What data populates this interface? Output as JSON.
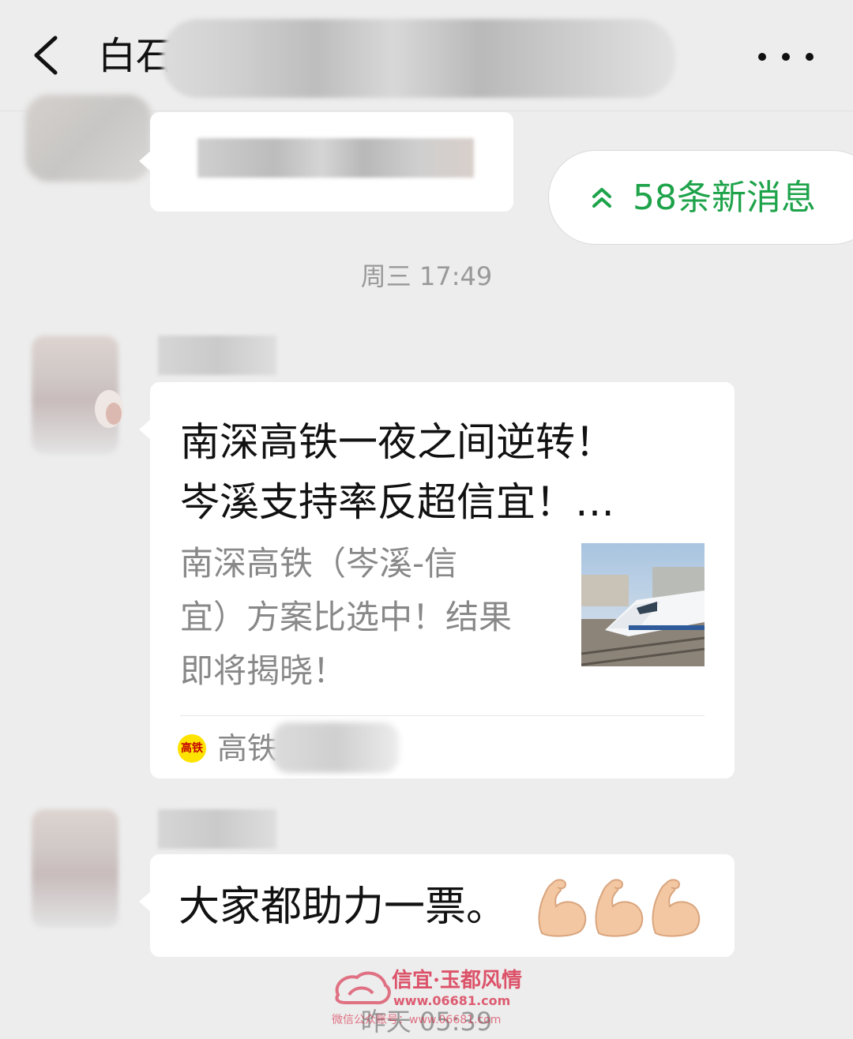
{
  "header": {
    "title": "白石",
    "back_icon": "chevron-left-icon",
    "more_icon": "more-dots-icon"
  },
  "new_messages": {
    "label": "58条新消息",
    "icon": "double-chevron-up-icon",
    "color": "#1ea34a"
  },
  "timestamps": {
    "first": "周三 17:49",
    "second": "昨天 05:39"
  },
  "link_card": {
    "title_line1": "南深高铁一夜之间逆转！",
    "title_line2": "岑溪支持率反超信宜！…",
    "desc_line1": "南深高铁（岑溪-信",
    "desc_line2": "宜）方案比选中！结果",
    "desc_line3": "即将揭晓！",
    "source_icon_text": "高铁",
    "source_name": "高铁"
  },
  "text_message": {
    "text": "大家都助力一票。",
    "emoji": "flexed-biceps-icon"
  },
  "watermark": {
    "name": "信宜·玉都风情",
    "url": "www.06681.com",
    "sub": "微信公众账号：www.06681.com"
  }
}
